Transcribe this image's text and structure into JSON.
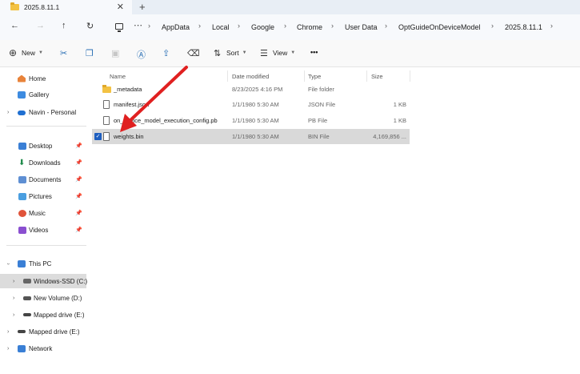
{
  "tab": {
    "title": "2025.8.11.1",
    "close": "✕",
    "new": "+"
  },
  "nav": {
    "back": "←",
    "forward": "→",
    "up": "↑",
    "refresh": "↻",
    "more": "⋯"
  },
  "breadcrumb": [
    "AppData",
    "Local",
    "Google",
    "Chrome",
    "User Data",
    "OptGuideOnDeviceModel",
    "2025.8.11.1"
  ],
  "commands": {
    "new_label": "New",
    "sort_label": "Sort",
    "view_label": "View",
    "more": "•••"
  },
  "icons": {
    "cut": "✂",
    "copy": "❐",
    "paste": "📋",
    "rename": "Ⓐ",
    "share": "⇪",
    "delete": "🗑"
  },
  "sidebar": {
    "top": [
      {
        "label": "Home",
        "icon": "home-icon"
      },
      {
        "label": "Gallery",
        "icon": "gallery-icon"
      },
      {
        "label": "Navin - Personal",
        "icon": "cloud-icon"
      }
    ],
    "quick": [
      {
        "label": "Desktop",
        "icon": "desktop-icon"
      },
      {
        "label": "Downloads",
        "icon": "downloads-icon"
      },
      {
        "label": "Documents",
        "icon": "documents-icon"
      },
      {
        "label": "Pictures",
        "icon": "pictures-icon"
      },
      {
        "label": "Music",
        "icon": "music-icon"
      },
      {
        "label": "Videos",
        "icon": "videos-icon"
      }
    ],
    "devices": [
      {
        "label": "This PC"
      },
      {
        "label": "Windows-SSD (C:)"
      },
      {
        "label": "New Volume (D:)"
      },
      {
        "label": "Mapped drive (E:)"
      },
      {
        "label": "Mapped drive (E:)"
      },
      {
        "label": "Network"
      }
    ]
  },
  "columns": {
    "name": "Name",
    "date": "Date modified",
    "type": "Type",
    "size": "Size"
  },
  "files": [
    {
      "name": "_metadata",
      "date": "8/23/2025 4:16 PM",
      "type": "File folder",
      "size": ""
    },
    {
      "name": "manifest.json",
      "date": "1/1/1980 5:30 AM",
      "type": "JSON File",
      "size": "1 KB"
    },
    {
      "name": "on_device_model_execution_config.pb",
      "date": "1/1/1980 5:30 AM",
      "type": "PB File",
      "size": "1 KB"
    },
    {
      "name": "weights.bin",
      "date": "1/1/1980 5:30 AM",
      "type": "BIN File",
      "size": "4,169,856 ..."
    }
  ],
  "colors": {
    "accent": "#1f5fbf",
    "annotation_arrow": "#e02020",
    "selection": "#d9d9d9"
  }
}
